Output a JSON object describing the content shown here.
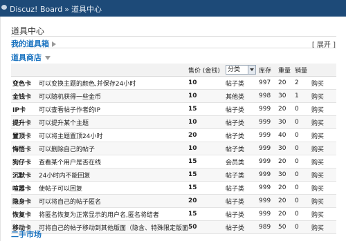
{
  "breadcrumb": {
    "site": "Discuz! Board",
    "separator": "»",
    "current": "道具中心"
  },
  "page": {
    "title": "道具中心"
  },
  "my_box": {
    "label": "我的道具箱",
    "expand": "[ 展开 ]"
  },
  "shop": {
    "label": "道具商店"
  },
  "table": {
    "headers": {
      "price": "售价 (金钱)",
      "category": "分类",
      "stock": "库存",
      "weight": "重量",
      "sales": "销量"
    },
    "rows": [
      {
        "name": "变色卡",
        "desc": "可以变换主题的颜色,并保存24小时",
        "price": "10",
        "cat": "帖子类",
        "stock": "997",
        "weight": "20",
        "sales": "2",
        "action": "购买"
      },
      {
        "name": "金钱卡",
        "desc": "可以随机获得一些金币",
        "price": "10",
        "cat": "其他类",
        "stock": "998",
        "weight": "30",
        "sales": "1",
        "action": "购买"
      },
      {
        "name": "IP卡",
        "desc": "可以查看帖子作者的IP",
        "price": "15",
        "cat": "帖子类",
        "stock": "999",
        "weight": "20",
        "sales": "0",
        "action": "购买"
      },
      {
        "name": "提升卡",
        "desc": "可以提升某个主题",
        "price": "10",
        "cat": "帖子类",
        "stock": "999",
        "weight": "30",
        "sales": "0",
        "action": "购买"
      },
      {
        "name": "置顶卡",
        "desc": "可以将主题置顶24小时",
        "price": "20",
        "cat": "帖子类",
        "stock": "999",
        "weight": "40",
        "sales": "0",
        "action": "购买"
      },
      {
        "name": "悔悟卡",
        "desc": "可以删除自己的帖子",
        "price": "10",
        "cat": "帖子类",
        "stock": "999",
        "weight": "30",
        "sales": "0",
        "action": "购买"
      },
      {
        "name": "狗仔卡",
        "desc": "查看某个用户是否在线",
        "price": "15",
        "cat": "会员类",
        "stock": "999",
        "weight": "20",
        "sales": "0",
        "action": "购买"
      },
      {
        "name": "沉默卡",
        "desc": "24小时内不能回复",
        "price": "15",
        "cat": "帖子类",
        "stock": "999",
        "weight": "30",
        "sales": "0",
        "action": "购买"
      },
      {
        "name": "喧嚣卡",
        "desc": "使帖子可以回复",
        "price": "15",
        "cat": "帖子类",
        "stock": "999",
        "weight": "20",
        "sales": "0",
        "action": "购买"
      },
      {
        "name": "隐身卡",
        "desc": "可以将自己的帖子匿名",
        "price": "20",
        "cat": "帖子类",
        "stock": "999",
        "weight": "20",
        "sales": "0",
        "action": "购买"
      },
      {
        "name": "恢复卡",
        "desc": "将匿名恢复为正常显示的用户名,匿名将结者",
        "price": "15",
        "cat": "帖子类",
        "stock": "999",
        "weight": "20",
        "sales": "0",
        "action": "购买"
      },
      {
        "name": "移动卡",
        "desc": "可将自己的帖子移动到其他版面（隐含、特殊限定版面除外）",
        "price": "50",
        "cat": "帖子类",
        "stock": "989",
        "weight": "50",
        "sales": "0",
        "action": "购买"
      }
    ]
  },
  "market": {
    "label": "二手市场"
  }
}
